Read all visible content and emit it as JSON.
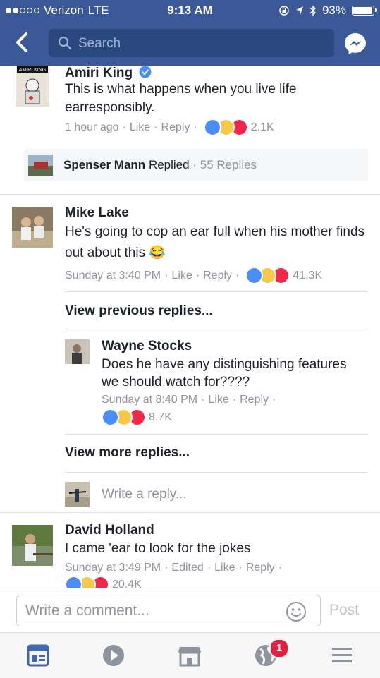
{
  "status_bar": {
    "carrier": "Verizon",
    "network": "LTE",
    "time": "9:13 AM",
    "battery": "93%"
  },
  "nav": {
    "search_placeholder": "Search"
  },
  "comments": [
    {
      "name": "Amiri King",
      "verified": true,
      "text": "This is what happens when you live life earresponsibly.",
      "time": "1 hour ago",
      "like": "Like",
      "reply": "Reply",
      "reaction_count": "2.1K",
      "replied_summary": {
        "name": "Spenser Mann",
        "action": "Replied",
        "count": "55 Replies"
      }
    },
    {
      "name": "Mike Lake",
      "text": "He's going to cop an ear full when his mother finds out about this",
      "emoji": "😂",
      "time": "Sunday at 3:40 PM",
      "like": "Like",
      "reply": "Reply",
      "reaction_count": "41.3K",
      "view_previous": "View previous replies...",
      "nested_reply": {
        "name": "Wayne Stocks",
        "text": "Does he have any distinguishing features we should watch for????",
        "time": "Sunday at 8:40 PM",
        "like": "Like",
        "reply": "Reply",
        "reaction_count": "8.7K"
      },
      "view_more": "View more replies...",
      "write_reply_placeholder": "Write a reply..."
    },
    {
      "name": "David Holland",
      "text": "I came 'ear to look for the jokes",
      "time": "Sunday at 3:49 PM",
      "edited": "Edited",
      "like": "Like",
      "reply": "Reply",
      "reaction_count": "20.4K"
    }
  ],
  "composer": {
    "placeholder": "Write a comment...",
    "post_label": "Post"
  },
  "tabbar": {
    "items": [
      "news-feed-icon",
      "video-icon",
      "marketplace-icon",
      "notifications-globe-icon",
      "menu-icon"
    ],
    "notification_badge": "1"
  },
  "colors": {
    "brand": "#3b5998",
    "like": "#4b8ef7",
    "haha": "#f7c948",
    "love": "#f0284a",
    "badge": "#e41e3f"
  }
}
